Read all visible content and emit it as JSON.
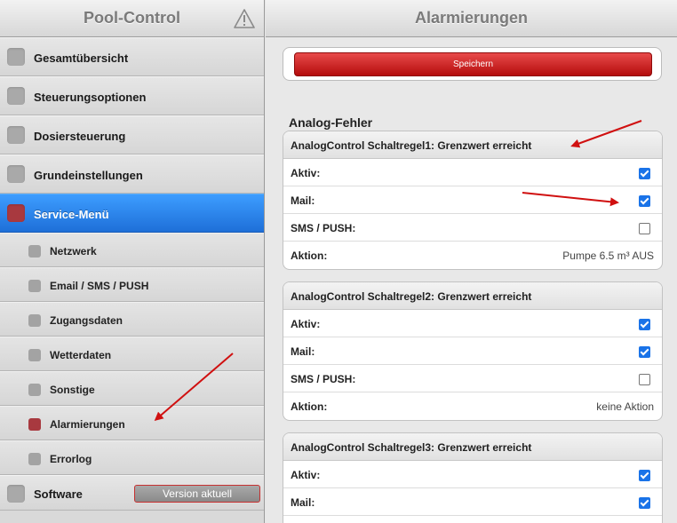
{
  "sidebar": {
    "title": "Pool-Control",
    "items": [
      {
        "label": "Gesamtübersicht"
      },
      {
        "label": "Steuerungsoptionen"
      },
      {
        "label": "Dosiersteuerung"
      },
      {
        "label": "Grundeinstellungen"
      },
      {
        "label": "Service-Menü"
      }
    ],
    "subitems": [
      {
        "label": "Netzwerk"
      },
      {
        "label": "Email / SMS / PUSH"
      },
      {
        "label": "Zugangsdaten"
      },
      {
        "label": "Wetterdaten"
      },
      {
        "label": "Sonstige"
      },
      {
        "label": "Alarmierungen"
      },
      {
        "label": "Errorlog"
      }
    ],
    "software": {
      "label": "Software",
      "version_label": "Version aktuell"
    }
  },
  "main": {
    "title": "Alarmierungen",
    "save_label": "Speichern",
    "section_title": "Analog-Fehler",
    "cards": [
      {
        "title": "AnalogControl Schaltregel1: Grenzwert erreicht",
        "aktiv_label": "Aktiv:",
        "aktiv": true,
        "mail_label": "Mail:",
        "mail": true,
        "sms_label": "SMS / PUSH:",
        "sms": false,
        "aktion_label": "Aktion:",
        "aktion": "Pumpe 6.5 m³ AUS"
      },
      {
        "title": "AnalogControl Schaltregel2: Grenzwert erreicht",
        "aktiv_label": "Aktiv:",
        "aktiv": true,
        "mail_label": "Mail:",
        "mail": true,
        "sms_label": "SMS / PUSH:",
        "sms": false,
        "aktion_label": "Aktion:",
        "aktion": "keine Aktion"
      },
      {
        "title": "AnalogControl Schaltregel3: Grenzwert erreicht",
        "aktiv_label": "Aktiv:",
        "aktiv": true,
        "mail_label": "Mail:",
        "mail": true
      }
    ]
  },
  "colors": {
    "accent": "#1e6fd8",
    "alert": "#d01010",
    "active_bullet": "#a8393f"
  }
}
